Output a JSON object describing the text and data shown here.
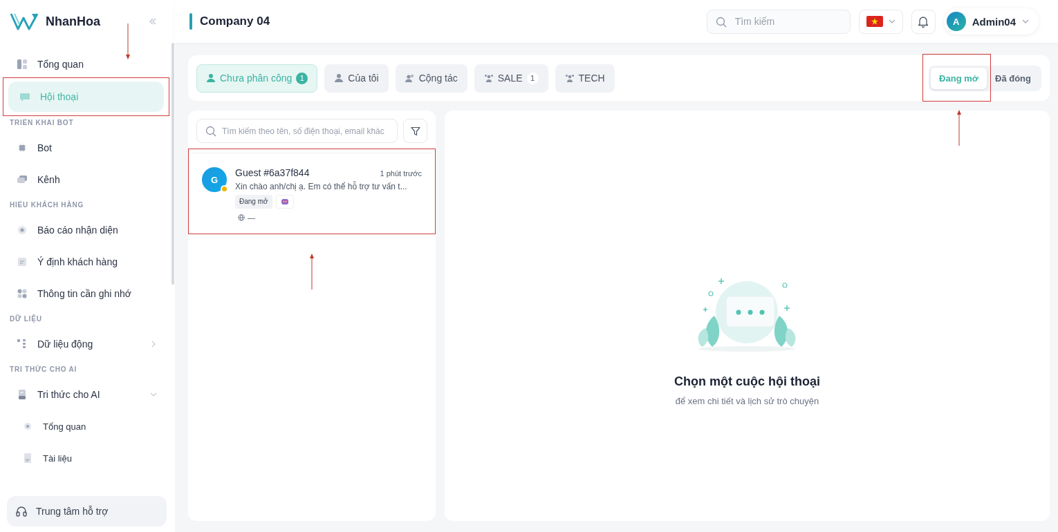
{
  "sidebar": {
    "logo": "NhanHoa",
    "items": [
      {
        "kind": "item",
        "label": "Tổng quan",
        "selected": false
      },
      {
        "kind": "item",
        "label": "Hội thoại",
        "selected": true,
        "highlighted": true
      },
      {
        "kind": "section",
        "label": "TRIỂN KHAI BOT"
      },
      {
        "kind": "item",
        "label": "Bot",
        "selected": false
      },
      {
        "kind": "item",
        "label": "Kênh",
        "selected": false
      },
      {
        "kind": "section",
        "label": "HIỂU KHÁCH HÀNG"
      },
      {
        "kind": "item",
        "label": "Báo cáo nhận diện",
        "selected": false
      },
      {
        "kind": "item",
        "label": "Ý định khách hàng",
        "selected": false
      },
      {
        "kind": "item",
        "label": "Thông tin cần ghi nhớ",
        "selected": false
      },
      {
        "kind": "section",
        "label": "DỮ LIỆU"
      },
      {
        "kind": "item",
        "label": "Dữ liệu động",
        "selected": false,
        "expanded": false
      },
      {
        "kind": "section",
        "label": "TRI THỨC CHO AI"
      },
      {
        "kind": "item",
        "label": "Tri thức cho AI",
        "selected": false,
        "expanded": true
      },
      {
        "kind": "subitem",
        "label": "Tổng quan",
        "selected": false
      },
      {
        "kind": "subitem",
        "label": "Tài liệu",
        "selected": false
      }
    ],
    "support": "Trung tâm hỗ trợ"
  },
  "header": {
    "title": "Company 04",
    "search": {
      "placeholder": "Tìm kiếm"
    },
    "user": {
      "initial": "A",
      "name": "Admin04"
    }
  },
  "tabs": [
    {
      "label": "Chưa phân công",
      "count": "1",
      "selected": true
    },
    {
      "label": "Của tôi",
      "selected": false
    },
    {
      "label": "Cộng tác",
      "selected": false
    },
    {
      "label": "SALE",
      "count": "1",
      "selected": false
    },
    {
      "label": "TECH",
      "selected": false
    }
  ],
  "status_toggle": {
    "options": [
      {
        "label": "Đang mở",
        "selected": true
      },
      {
        "label": "Đã đóng",
        "selected": false
      }
    ],
    "highlighted": true
  },
  "conversation_list": {
    "search": {
      "placeholder": "Tìm kiếm theo tên, số điện thoại, email khác"
    },
    "items": [
      {
        "initial": "G",
        "name": "Guest #6a37f844",
        "time": "1 phút trước",
        "preview": "Xin chào anh/chị ạ. Em có thể hỗ trợ tư vấn t...",
        "status_tag": "Đang mở",
        "channel": "—",
        "selected": false,
        "highlighted": true
      }
    ]
  },
  "empty_state": {
    "title": "Chọn một cuộc hội thoại",
    "subtitle": "để xem chi tiết và lịch sử trò chuyện"
  }
}
